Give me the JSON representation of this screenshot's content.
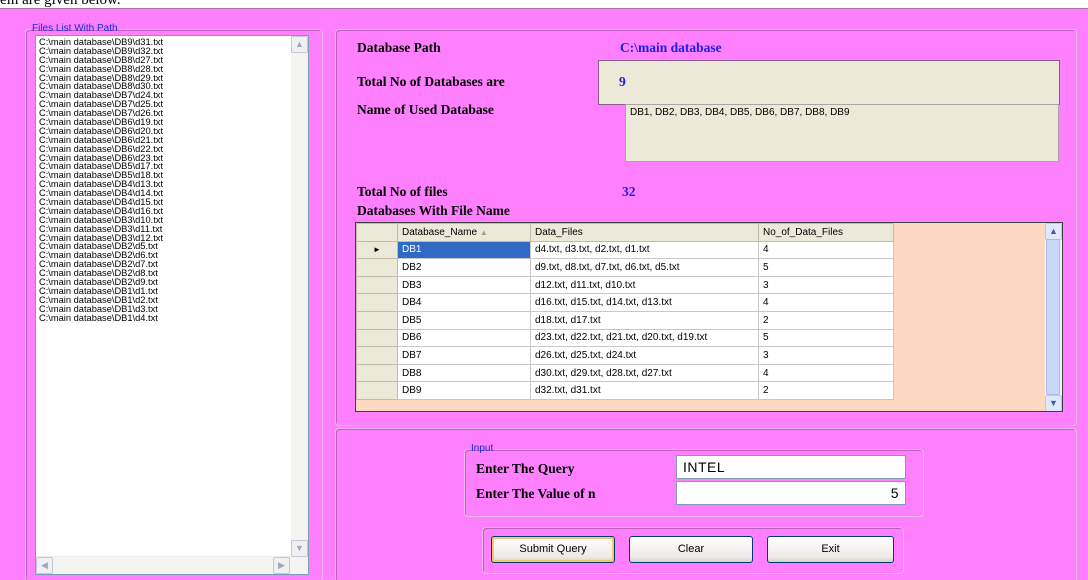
{
  "caption_fragment": "ein are given below.",
  "files_group": {
    "legend": "Files List With Path",
    "items": [
      "C:\\main database\\DB9\\d31.txt",
      "C:\\main database\\DB9\\d32.txt",
      "C:\\main database\\DB8\\d27.txt",
      "C:\\main database\\DB8\\d28.txt",
      "C:\\main database\\DB8\\d29.txt",
      "C:\\main database\\DB8\\d30.txt",
      "C:\\main database\\DB7\\d24.txt",
      "C:\\main database\\DB7\\d25.txt",
      "C:\\main database\\DB7\\d26.txt",
      "C:\\main database\\DB6\\d19.txt",
      "C:\\main database\\DB6\\d20.txt",
      "C:\\main database\\DB6\\d21.txt",
      "C:\\main database\\DB6\\d22.txt",
      "C:\\main database\\DB6\\d23.txt",
      "C:\\main database\\DB5\\d17.txt",
      "C:\\main database\\DB5\\d18.txt",
      "C:\\main database\\DB4\\d13.txt",
      "C:\\main database\\DB4\\d14.txt",
      "C:\\main database\\DB4\\d15.txt",
      "C:\\main database\\DB4\\d16.txt",
      "C:\\main database\\DB3\\d10.txt",
      "C:\\main database\\DB3\\d11.txt",
      "C:\\main database\\DB3\\d12.txt",
      "C:\\main database\\DB2\\d5.txt",
      "C:\\main database\\DB2\\d6.txt",
      "C:\\main database\\DB2\\d7.txt",
      "C:\\main database\\DB2\\d8.txt",
      "C:\\main database\\DB2\\d9.txt",
      "C:\\main database\\DB1\\d1.txt",
      "C:\\main database\\DB1\\d2.txt",
      "C:\\main database\\DB1\\d3.txt",
      "C:\\main database\\DB1\\d4.txt"
    ]
  },
  "info": {
    "db_path_label": "Database Path",
    "db_path_value": "C:\\main database",
    "total_db_label": "Total No of Databases are",
    "total_db_value": "9",
    "used_db_label": "Name of Used Database",
    "used_db_value": "DB1, DB2, DB3, DB4, DB5, DB6, DB7, DB8, DB9",
    "total_files_label": "Total No of  files",
    "total_files_value": "32",
    "grid_label": "Databases With File Name"
  },
  "grid": {
    "columns": [
      "Database_Name",
      "Data_Files",
      "No_of_Data_Files"
    ],
    "current_row_marker": "►",
    "rows": [
      [
        "DB1",
        "d4.txt, d3.txt, d2.txt, d1.txt",
        "4"
      ],
      [
        "DB2",
        "d9.txt, d8.txt, d7.txt, d6.txt, d5.txt",
        "5"
      ],
      [
        "DB3",
        "d12.txt, d11.txt, d10.txt",
        "3"
      ],
      [
        "DB4",
        "d16.txt, d15.txt, d14.txt, d13.txt",
        "4"
      ],
      [
        "DB5",
        "d18.txt, d17.txt",
        "2"
      ],
      [
        "DB6",
        "d23.txt, d22.txt, d21.txt, d20.txt, d19.txt",
        "5"
      ],
      [
        "DB7",
        "d26.txt, d25.txt, d24.txt",
        "3"
      ],
      [
        "DB8",
        "d30.txt, d29.txt, d28.txt, d27.txt",
        "4"
      ],
      [
        "DB9",
        "d32.txt, d31.txt",
        "2"
      ]
    ]
  },
  "input_group": {
    "legend": "Input",
    "query_label": "Enter The Query",
    "query_value": "INTEL",
    "n_label": "Enter The Value of n",
    "n_value": "5"
  },
  "buttons": {
    "submit": "Submit Query",
    "clear": "Clear",
    "exit": "Exit"
  },
  "colors": {
    "form_background": "#ff80ff",
    "grid_background": "#fdd9c3",
    "selection": "#316ac5",
    "value_text": "#2020e0"
  }
}
